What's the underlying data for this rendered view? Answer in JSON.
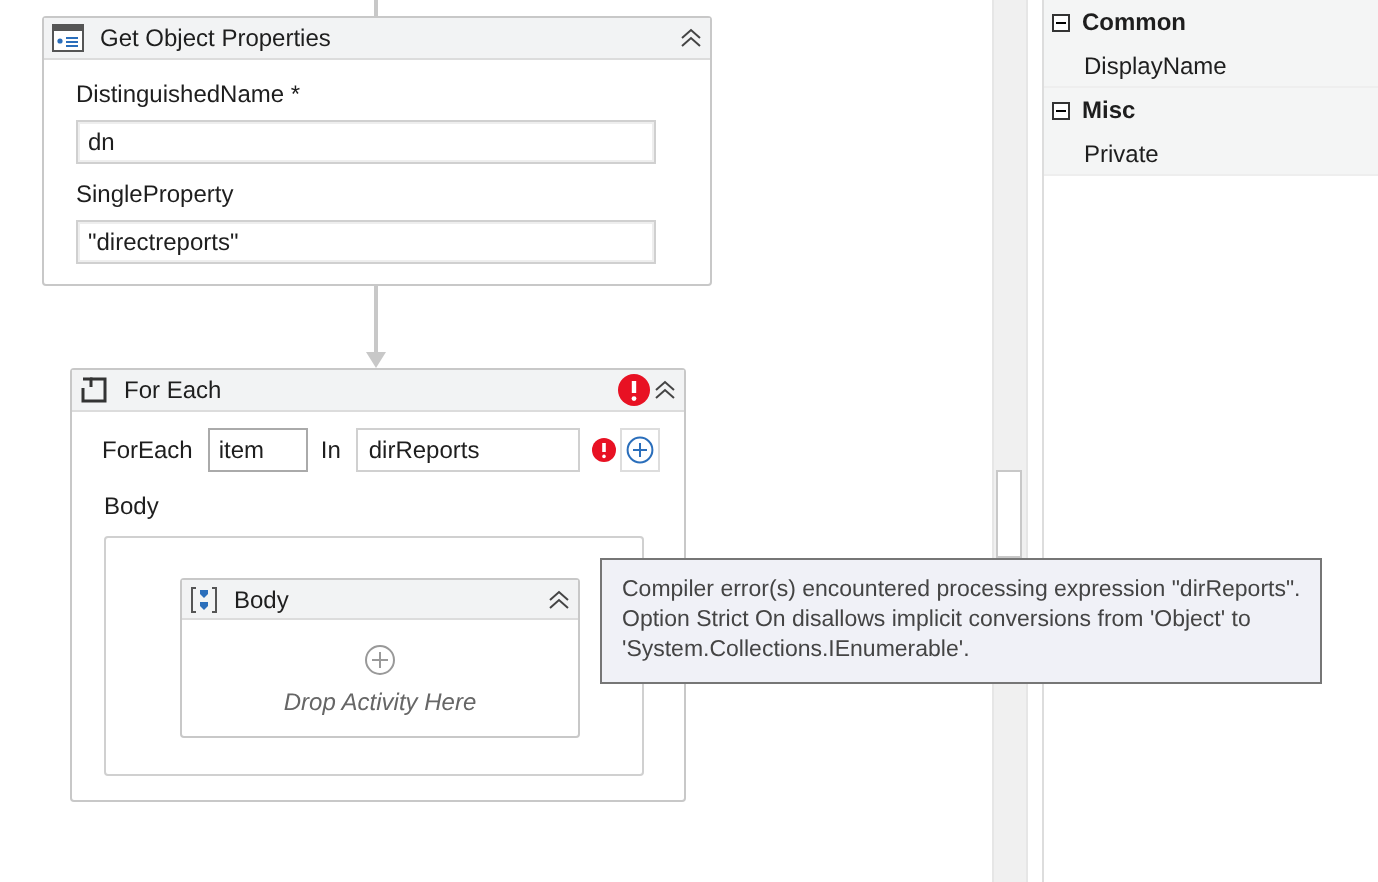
{
  "get_object_properties": {
    "title": "Get Object Properties",
    "fields": [
      {
        "label": "DistinguishedName *",
        "value": "dn"
      },
      {
        "label": "SingleProperty",
        "value": "\"directreports\""
      }
    ]
  },
  "for_each": {
    "title": "For Each",
    "has_error": true,
    "foreach_label": "ForEach",
    "item_value": "item",
    "in_label": "In",
    "collection_value": "dirReports",
    "collection_error": true,
    "body_label": "Body",
    "body": {
      "title": "Body",
      "placeholder": "Drop Activity Here"
    }
  },
  "tooltip": {
    "lines": [
      "Compiler error(s) encountered processing expression \"dirReports\".",
      "Option Strict On disallows implicit conversions from 'Object' to",
      "'System.Collections.IEnumerable'."
    ]
  },
  "properties": {
    "categories": [
      {
        "name": "Common",
        "expanded": true,
        "items": [
          {
            "name": "DisplayName"
          }
        ]
      },
      {
        "name": "Misc",
        "expanded": true,
        "items": [
          {
            "name": "Private"
          }
        ]
      }
    ]
  }
}
